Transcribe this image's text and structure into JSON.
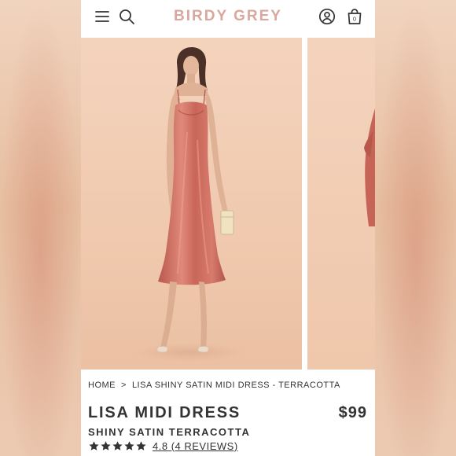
{
  "header": {
    "brand": "BIRDY GREY",
    "cart_count": "0"
  },
  "breadcrumb": {
    "home": "HOME",
    "separator": ">",
    "current": "LISA SHINY SATIN MIDI DRESS - TERRACOTTA"
  },
  "product": {
    "title": "LISA MIDI DRESS",
    "price": "$99",
    "subtitle": "SHINY SATIN TERRACOTTA",
    "rating_value": "4.8",
    "reviews_label": "(4 REVIEWS)",
    "stars_filled": 5
  },
  "colors": {
    "brand": "#d9a79e",
    "dress": "#c9675a",
    "text": "#333333"
  }
}
